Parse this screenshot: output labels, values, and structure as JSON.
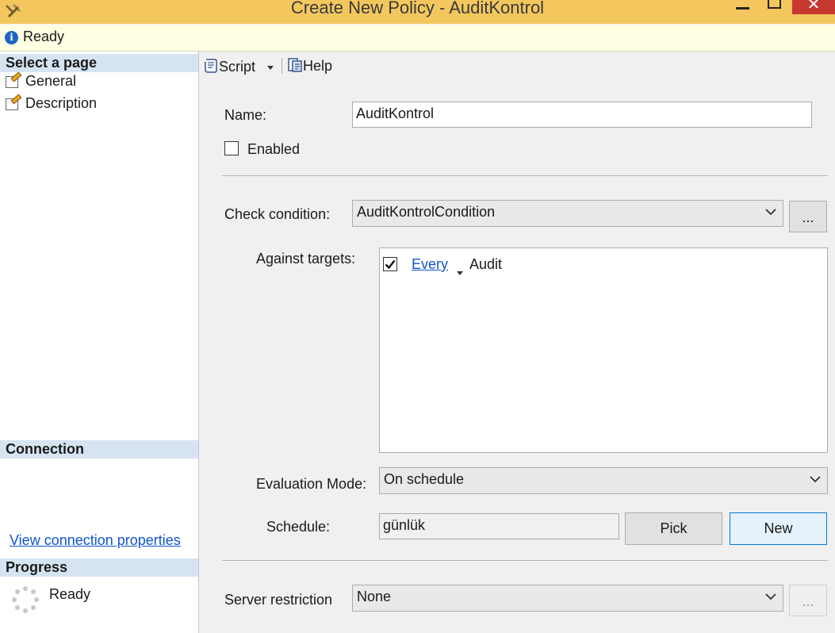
{
  "window": {
    "title": "Create New Policy - AuditKontrol",
    "close_glyph": "✕"
  },
  "status": {
    "text": "Ready",
    "icon": "info-icon"
  },
  "left_pane": {
    "select_page_header": "Select a page",
    "pages": [
      {
        "label": "General",
        "icon": "page-edit-icon"
      },
      {
        "label": "Description",
        "icon": "page-edit-icon"
      }
    ],
    "connection_header": "Connection",
    "connection_link": "View connection properties",
    "progress_header": "Progress",
    "progress_status": "Ready"
  },
  "toolbar": {
    "script_label": "Script",
    "help_label": "Help"
  },
  "form": {
    "name_label": "Name:",
    "name_value": "AuditKontrol",
    "enabled_label": "Enabled",
    "enabled_checked": false,
    "check_condition_label": "Check condition:",
    "check_condition_value": "AuditKontrolCondition",
    "ellipsis_label": "...",
    "against_targets_label": "Against targets:",
    "targets": [
      {
        "checked": true,
        "link": "Every",
        "target": "Audit"
      }
    ],
    "evaluation_mode_label": "Evaluation Mode:",
    "evaluation_mode_value": "On schedule",
    "schedule_label": "Schedule:",
    "schedule_value": "günlük",
    "pick_label": "Pick",
    "new_label": "New",
    "server_restriction_label": "Server restriction",
    "server_restriction_value": "None",
    "server_ellipsis_label": "..."
  },
  "colors": {
    "titlebar": "#f3c75e",
    "close_button": "#c7392e",
    "status_bar": "#ffffe3",
    "section_header": "#d6e4f2",
    "link": "#1155cc"
  }
}
